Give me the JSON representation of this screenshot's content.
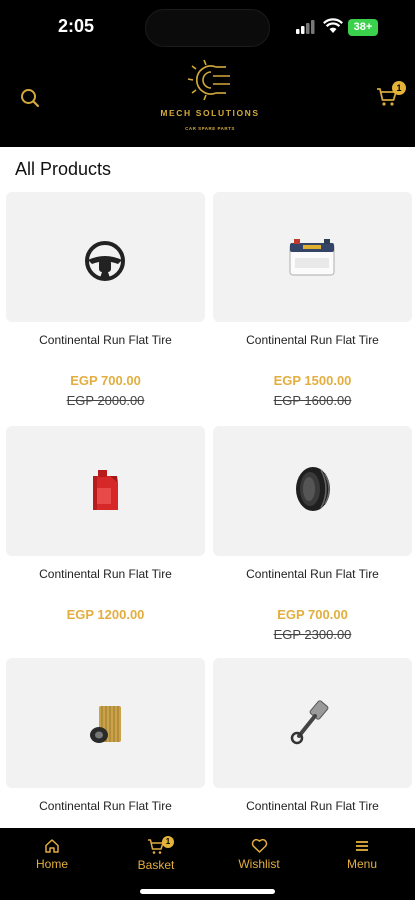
{
  "status": {
    "time": "2:05",
    "battery": "38+"
  },
  "header": {
    "brand_name": "MECH SOLUTIONS",
    "brand_tagline": "CAR SPARE PARTS",
    "cart_count": "1",
    "icons": {
      "search": "search-icon",
      "cart": "cart-icon"
    }
  },
  "section_title": "All Products",
  "products": [
    {
      "name": "Continental Run Flat Tire",
      "price": "EGP 700.00",
      "old_price": "EGP 2000.00",
      "icon": "steering-wheel-icon"
    },
    {
      "name": "Continental Run Flat Tire",
      "price": "EGP 1500.00",
      "old_price": "EGP 1600.00",
      "icon": "car-battery-icon"
    },
    {
      "name": "Continental Run Flat Tire",
      "price": "EGP 1200.00",
      "old_price": "",
      "icon": "oil-canister-icon"
    },
    {
      "name": "Continental Run Flat Tire",
      "price": "EGP 700.00",
      "old_price": "EGP 2300.00",
      "icon": "tire-icon"
    },
    {
      "name": "Continental Run Flat Tire",
      "price": "",
      "old_price": "",
      "icon": "oil-filter-icon"
    },
    {
      "name": "Continental Run Flat Tire",
      "price": "",
      "old_price": "",
      "icon": "piston-icon"
    }
  ],
  "nav": {
    "home": "Home",
    "basket": "Basket",
    "basket_count": "1",
    "wishlist": "Wishlist",
    "menu": "Menu"
  },
  "colors": {
    "accent": "#e3ae3f",
    "header_bg": "#000000",
    "card_bg": "#f2f2f2"
  }
}
